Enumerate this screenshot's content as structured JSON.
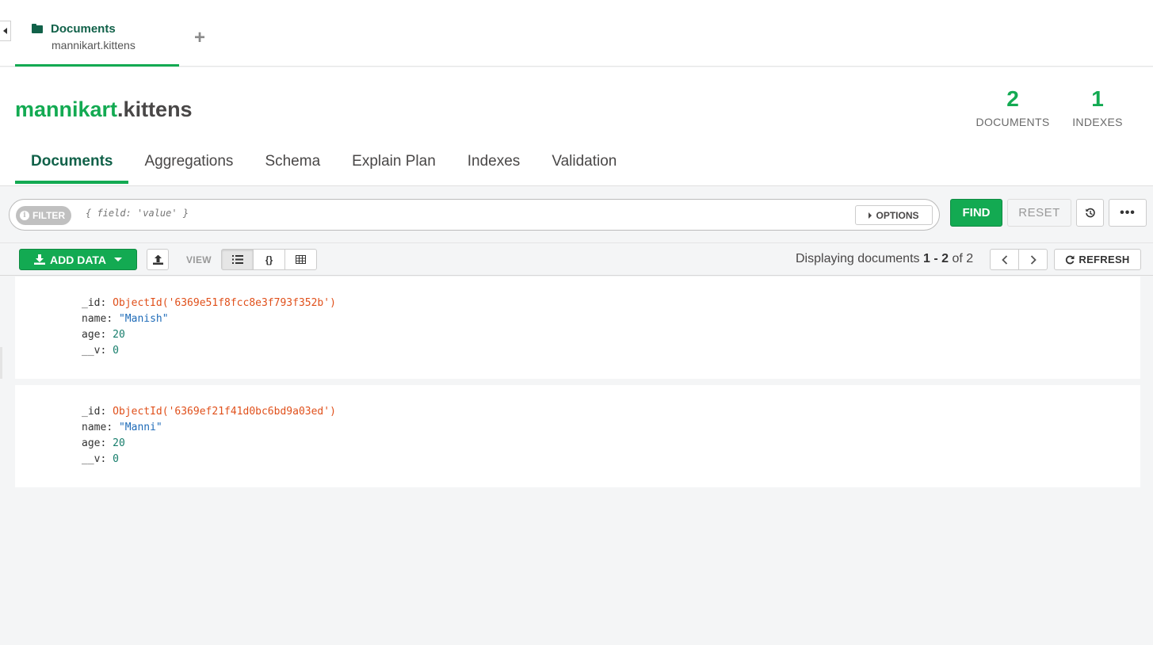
{
  "workspace_tab": {
    "title": "Documents",
    "subtitle": "mannikart.kittens",
    "new_tab_symbol": "+"
  },
  "header": {
    "db_name": "mannikart",
    "coll_name": ".kittens",
    "documents_count": "2",
    "documents_label": "DOCUMENTS",
    "indexes_count": "1",
    "indexes_label": "INDEXES"
  },
  "subtabs": [
    "Documents",
    "Aggregations",
    "Schema",
    "Explain Plan",
    "Indexes",
    "Validation"
  ],
  "query_bar": {
    "filter_label": "FILTER",
    "filter_placeholder": "{ field: 'value' }",
    "options_label": "OPTIONS",
    "find_label": "FIND",
    "reset_label": "RESET",
    "history_icon": "history-icon",
    "more_label": "•••"
  },
  "toolbar": {
    "add_data_label": "ADD DATA",
    "view_label": "VIEW",
    "view_modes": [
      "list-view-icon",
      "json-view-icon",
      "table-view-icon"
    ],
    "active_view": "list",
    "displaying_prefix": "Displaying documents",
    "range_start": "1",
    "range_sep": "-",
    "range_end": "2",
    "of_text": "of",
    "total": "2",
    "refresh_label": "REFRESH"
  },
  "documents": [
    {
      "id_key": "_id",
      "id_value": "ObjectId('6369e51f8fcc8e3f793f352b')",
      "name_key": "name",
      "name_value": "\"Manish\"",
      "age_key": "age",
      "age_value": "20",
      "v_key": "__v",
      "v_value": "0"
    },
    {
      "id_key": "_id",
      "id_value": "ObjectId('6369ef21f41d0bc6bd9a03ed')",
      "name_key": "name",
      "name_value": "\"Manni\"",
      "age_key": "age",
      "age_value": "20",
      "v_key": "__v",
      "v_value": "0"
    }
  ],
  "colors": {
    "brand_green": "#13aa52",
    "dark_green": "#116149",
    "objectid": "#e0501b",
    "string": "#1e6bb8",
    "number": "#167d6b"
  }
}
